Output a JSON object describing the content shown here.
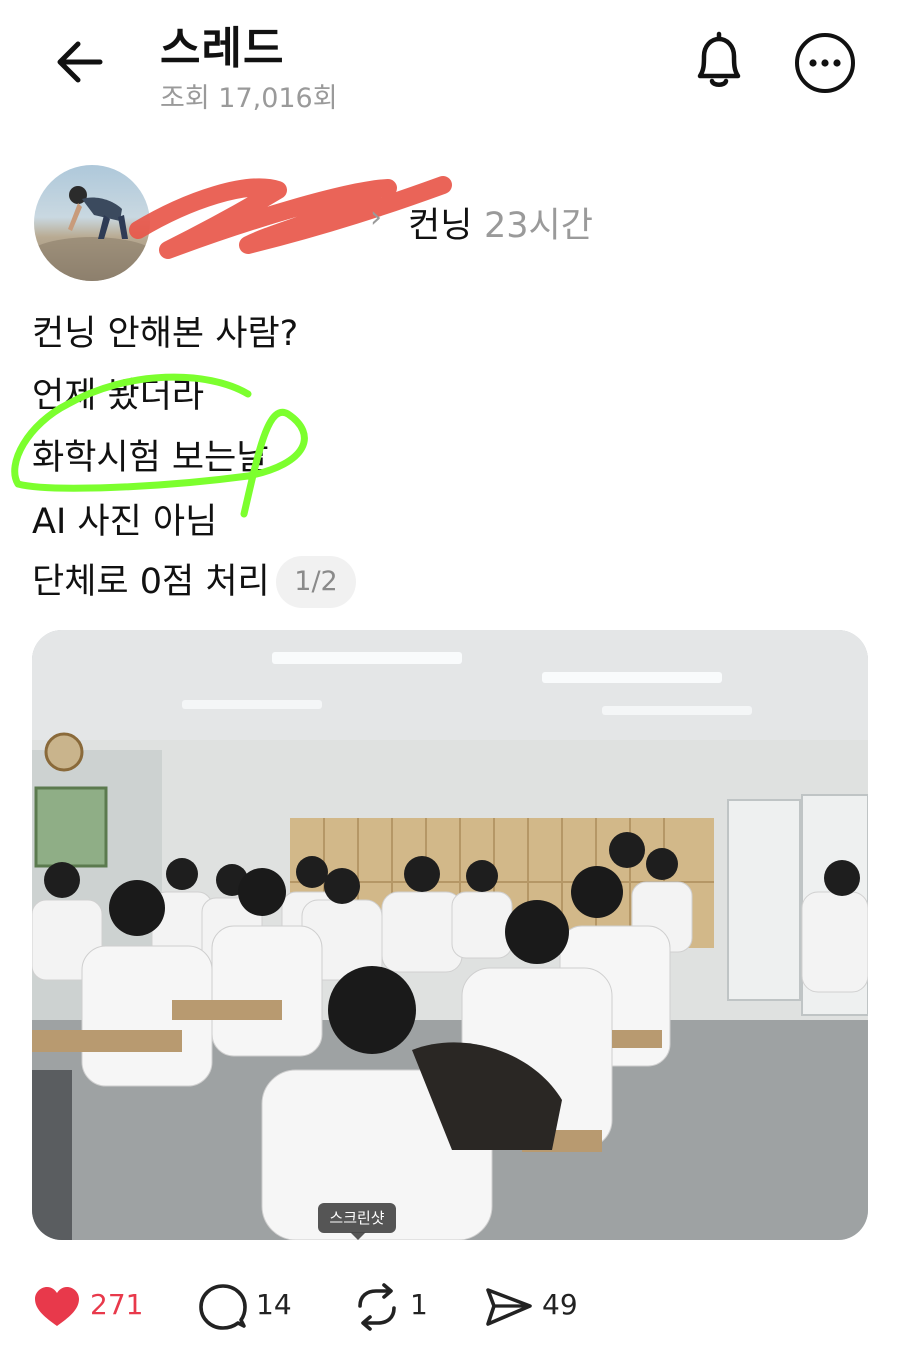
{
  "header": {
    "title": "스레드",
    "views": "조회 17,016회",
    "back_icon": "arrow-left-icon",
    "bell_icon": "bell-icon",
    "more_icon": "more-horizontal-icon"
  },
  "author": {
    "name_redacted": "",
    "separator": "›",
    "topic": "컨닝",
    "time": "23시간"
  },
  "post": {
    "lines": [
      "컨닝 안해본 사람?",
      "언제 봤더라",
      "화학시험 보는날",
      "AI 사진 아님",
      "단체로 0점 처리"
    ],
    "page_indicator": "1/2",
    "highlight_color": "#7cff2e",
    "redaction_color": "#e8574a"
  },
  "image": {
    "tooltip": "스크린샷"
  },
  "actions": {
    "like_count": "271",
    "comment_count": "14",
    "repost_count": "1",
    "share_count": "49",
    "like_color": "#e8394b"
  }
}
